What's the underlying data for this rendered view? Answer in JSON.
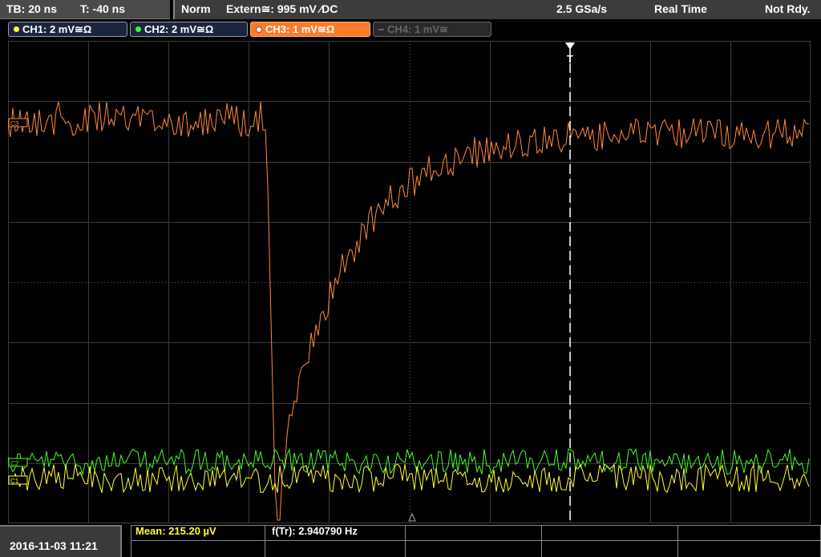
{
  "timebase": {
    "tb": "TB: 20 ns",
    "t": "T: -40 ns"
  },
  "status": {
    "mode": "Norm",
    "trigger": "Extern≅: 995 mV ⁄DC",
    "sample_rate": "2.5 GSa/s",
    "acq": "Real Time",
    "ready": "Not Rdy."
  },
  "channels": [
    {
      "label": "CH1: 2 mV≅Ω",
      "color": "#ffff33",
      "state": "on"
    },
    {
      "label": "CH2: 2 mV≅Ω",
      "color": "#33ff33",
      "state": "on"
    },
    {
      "label": "CH3: 1 mV≅Ω",
      "color": "#ff7a2a",
      "state": "active"
    },
    {
      "label": "CH4: 1 mV≅",
      "color": "#888888",
      "state": "off"
    }
  ],
  "markers": {
    "ch3": "C3",
    "ch2": "C2",
    "ch1": "C1",
    "trigger": "T"
  },
  "datetime": "2016-11-03 11:21",
  "measurements": {
    "mean": "Mean: 215.20 µV",
    "freq": "f(Tr): 2.940790 Hz"
  },
  "colors": {
    "ch1": "#ffff33",
    "ch2": "#33ff33",
    "ch3": "#ff8a3a",
    "grid": "#3a3a3a"
  }
}
